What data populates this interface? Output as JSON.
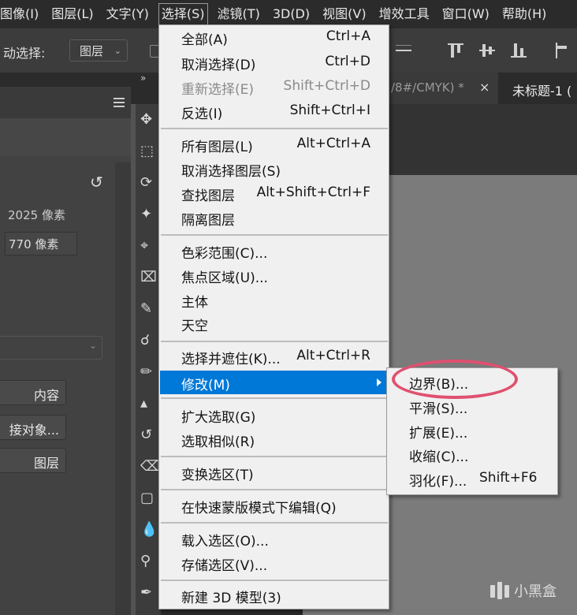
{
  "menubar": {
    "items": [
      "图像(I)",
      "图层(L)",
      "文字(Y)",
      "选择(S)",
      "滤镜(T)",
      "3D(D)",
      "视图(V)",
      "增效工具",
      "窗口(W)",
      "帮助(H)"
    ],
    "active": "选择(S)"
  },
  "optbar": {
    "auto_select_label": "动选择:",
    "auto_select_value": "图层"
  },
  "tabs": {
    "tab1_title": "/8#/CMYK) *",
    "tab1_close": "×",
    "tab2_title": "未标题-1 ("
  },
  "left_panel": {
    "width_value": "2025 像素",
    "height_value": "770 像素",
    "buttons": [
      "内容",
      "接对象...",
      "图层"
    ]
  },
  "select_menu": {
    "items": [
      {
        "label": "全部(A)",
        "shortcut": "Ctrl+A"
      },
      {
        "label": "取消选择(D)",
        "shortcut": "Ctrl+D"
      },
      {
        "label": "重新选择(E)",
        "shortcut": "Shift+Ctrl+D",
        "disabled": true
      },
      {
        "label": "反选(I)",
        "shortcut": "Shift+Ctrl+I"
      },
      {
        "label": "所有图层(L)",
        "shortcut": "Alt+Ctrl+A"
      },
      {
        "label": "取消选择图层(S)",
        "shortcut": ""
      },
      {
        "label": "查找图层",
        "shortcut": "Alt+Shift+Ctrl+F"
      },
      {
        "label": "隔离图层",
        "shortcut": ""
      },
      {
        "label": "色彩范围(C)...",
        "shortcut": ""
      },
      {
        "label": "焦点区域(U)...",
        "shortcut": ""
      },
      {
        "label": "主体",
        "shortcut": ""
      },
      {
        "label": "天空",
        "shortcut": ""
      },
      {
        "label": "选择并遮住(K)...",
        "shortcut": "Alt+Ctrl+R"
      },
      {
        "label": "修改(M)",
        "shortcut": "",
        "submenu": true
      },
      {
        "label": "扩大选取(G)",
        "shortcut": ""
      },
      {
        "label": "选取相似(R)",
        "shortcut": ""
      },
      {
        "label": "变换选区(T)",
        "shortcut": ""
      },
      {
        "label": "在快速蒙版模式下编辑(Q)",
        "shortcut": ""
      },
      {
        "label": "载入选区(O)...",
        "shortcut": ""
      },
      {
        "label": "存储选区(V)...",
        "shortcut": ""
      },
      {
        "label": "新建 3D 模型(3)",
        "shortcut": ""
      }
    ]
  },
  "modify_submenu": {
    "items": [
      {
        "label": "边界(B)...",
        "shortcut": ""
      },
      {
        "label": "平滑(S)...",
        "shortcut": ""
      },
      {
        "label": "扩展(E)...",
        "shortcut": ""
      },
      {
        "label": "收缩(C)...",
        "shortcut": ""
      },
      {
        "label": "羽化(F)...",
        "shortcut": "Shift+F6"
      }
    ]
  },
  "annotation": {
    "color": "#e0506f",
    "target": "边界(B)..."
  },
  "colors": {
    "menu_bg": "#f0f0f0",
    "highlight": "#0078d7",
    "menubar_bg": "#2b2b2b",
    "canvas": "#7b7b7b"
  },
  "watermark": {
    "text": "小黑盒",
    "icon": "xiaoheihe-logo-icon"
  }
}
